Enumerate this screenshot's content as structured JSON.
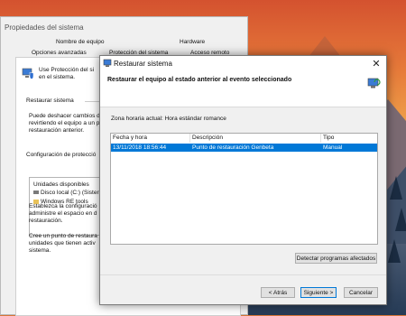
{
  "background_window": {
    "title": "Propiedades del sistema",
    "tabs": [
      "Nombre de equipo",
      "Hardware",
      "Opciones avanzadas",
      "Protección del sistema",
      "Acceso remoto"
    ],
    "intro_text": [
      "Use Protección del si",
      "en el sistema."
    ],
    "restore_group_label": "Restaurar sistema",
    "restore_text": [
      "Puede deshacer cambios de",
      "revirtiendo el equipo a un p",
      "restauración anterior."
    ],
    "protection_group_label": "Configuración de protecció",
    "drives_header": "Unidades disponibles",
    "drives": [
      "Disco local (C:) (Sister",
      "Windows RE tools"
    ],
    "config_text": [
      "Establezca la configuració",
      "administre el espacio en d",
      "restauración."
    ],
    "create_text": [
      "Cree un punto de restaura",
      "unidades que tienen activ",
      "sistema."
    ]
  },
  "dialog": {
    "title": "Restaurar sistema",
    "heading": "Restaurar el equipo al estado anterior al evento seleccionado",
    "timezone": "Zona horaria actual: Hora estándar romance",
    "columns": [
      "Fecha y hora",
      "Descripción",
      "Tipo"
    ],
    "rows": [
      {
        "date": "13/11/2018 18:56:44",
        "description": "Punto de restauración Genbeta",
        "type": "Manual"
      }
    ],
    "detect_button": "Detectar programas afectados",
    "back_button": "< Atrás",
    "next_button": "Siguiente >",
    "cancel_button": "Cancelar",
    "close_glyph": "✕"
  },
  "colors": {
    "selection": "#0078d7",
    "accent_border": "#0078d7",
    "window_bg": "#f0f0f0"
  }
}
